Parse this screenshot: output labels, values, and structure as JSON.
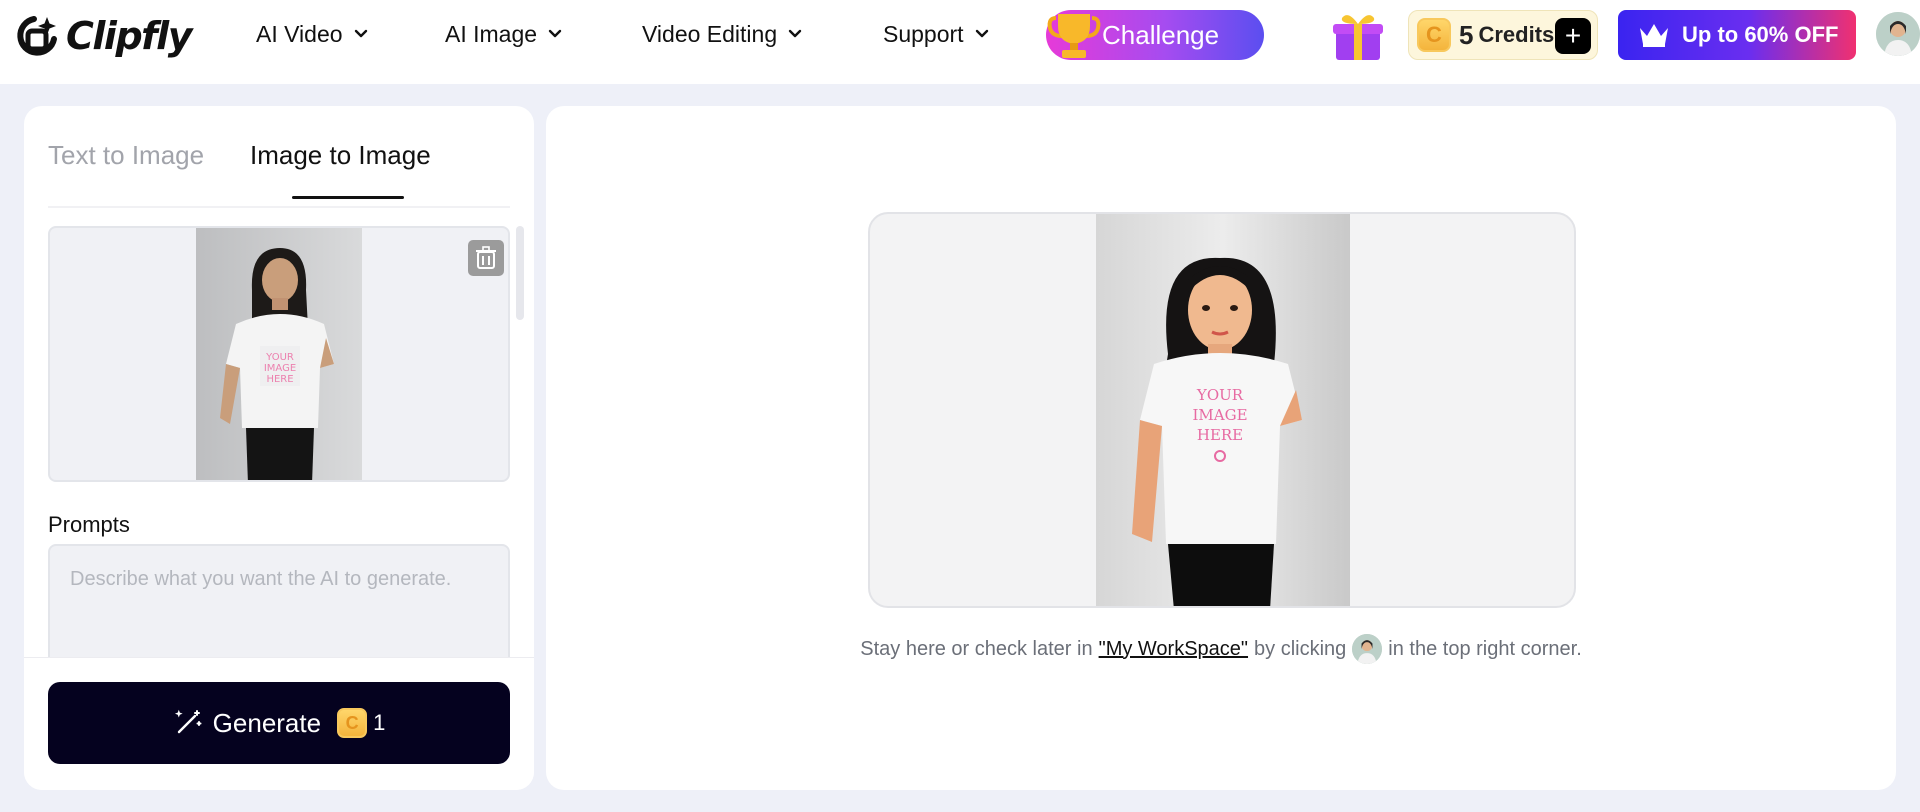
{
  "brand": {
    "name": "Clipfly"
  },
  "nav": [
    {
      "label": "AI Video"
    },
    {
      "label": "AI Image"
    },
    {
      "label": "Video Editing"
    },
    {
      "label": "Support"
    }
  ],
  "challenge": {
    "label": "Challenge"
  },
  "credits": {
    "count": "5",
    "label": "Credits",
    "coin_symbol": "C",
    "add_symbol": "+"
  },
  "promo": {
    "label": "Up to 60% OFF"
  },
  "tabs": [
    {
      "label": "Text to Image",
      "active": false
    },
    {
      "label": "Image to Image",
      "active": true
    }
  ],
  "prompts": {
    "label": "Prompts",
    "placeholder": "Describe what you want the AI to generate."
  },
  "generate": {
    "label": "Generate",
    "cost": "1",
    "coin_symbol": "C"
  },
  "status": {
    "prefix": "Stay here or check later in",
    "link": "\"My WorkSpace\"",
    "middle": "by clicking",
    "suffix": "in the top right corner."
  },
  "colors": {
    "generate_bg": "#05021f",
    "challenge_gradient_start": "#e63ad8",
    "challenge_gradient_end": "#5b4ef0",
    "promo_gradient_start": "#3a24f0",
    "promo_gradient_end": "#f03070",
    "coin": "#f4b43c",
    "page_bg": "#eef0f8"
  },
  "icons": {
    "logo": "clipfly-logo-icon",
    "nav_dropdown": "chevron-down-icon",
    "challenge": "trophy-icon",
    "gift": "gift-icon",
    "credits": "coin-icon",
    "promo": "crown-icon",
    "delete_upload": "trash-icon",
    "generate": "magic-wand-icon"
  }
}
